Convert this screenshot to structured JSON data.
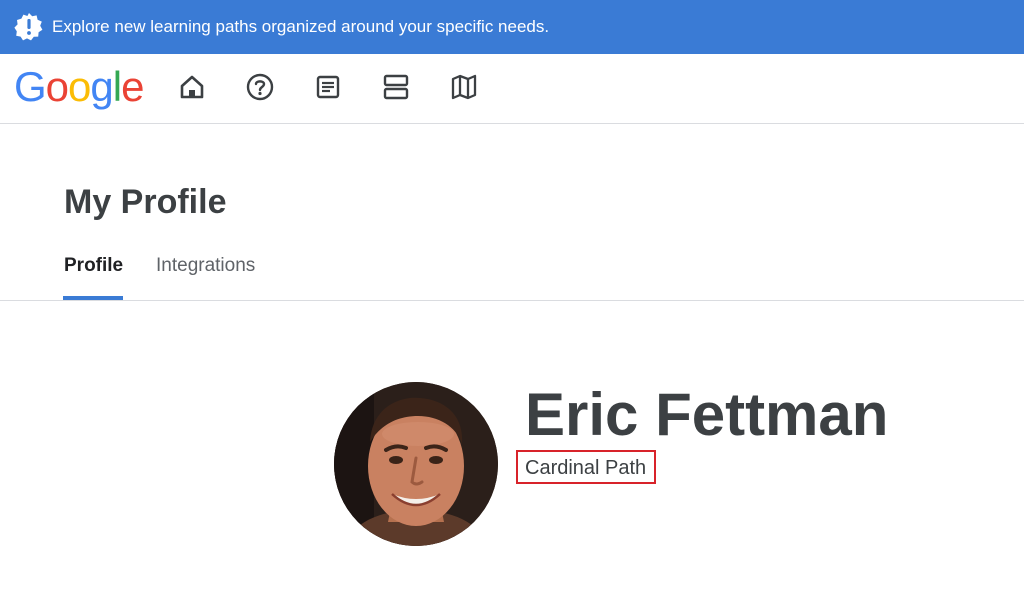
{
  "banner": {
    "text": "Explore new learning paths organized around your specific needs.",
    "icon": "alert-badge-icon",
    "color": "#3a7bd5"
  },
  "nav": {
    "logo": {
      "text": "Google",
      "letters": [
        {
          "char": "G",
          "color": "#4285F4"
        },
        {
          "char": "o",
          "color": "#EA4335"
        },
        {
          "char": "o",
          "color": "#FBBC05"
        },
        {
          "char": "g",
          "color": "#4285F4"
        },
        {
          "char": "l",
          "color": "#34A853"
        },
        {
          "char": "e",
          "color": "#EA4335"
        }
      ]
    },
    "icons": [
      "home-icon",
      "help-icon",
      "article-icon",
      "layout-icon",
      "map-icon"
    ]
  },
  "page": {
    "title": "My Profile",
    "tabs": [
      {
        "label": "Profile",
        "active": true
      },
      {
        "label": "Integrations",
        "active": false
      }
    ],
    "accent": "#3a7bd5"
  },
  "profile": {
    "name": "Eric Fettman",
    "company": "Cardinal Path",
    "highlight_color": "#d8232a"
  }
}
